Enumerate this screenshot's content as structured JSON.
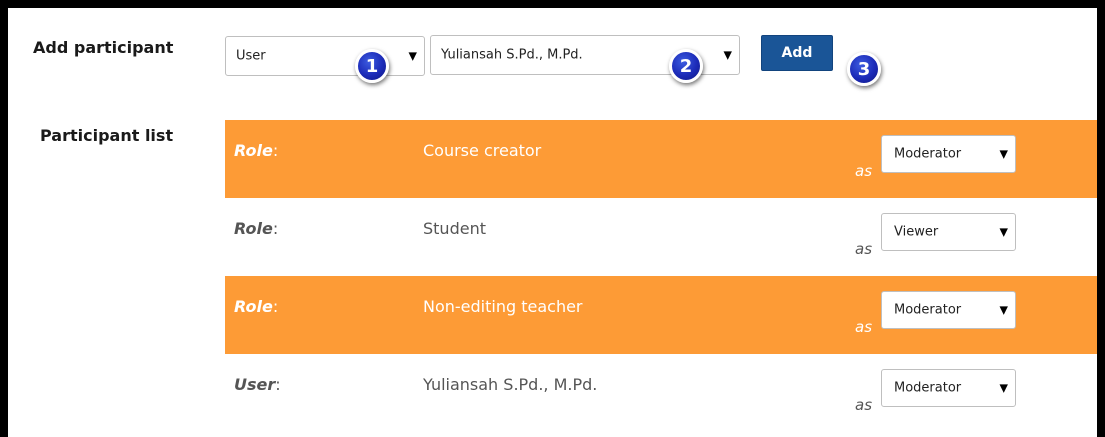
{
  "add_participant": {
    "label": "Add participant",
    "type_select_value": "User",
    "person_select_value": "Yuliansah S.Pd., M.Pd.",
    "add_button_label": "Add",
    "badges": [
      "1",
      "2",
      "3"
    ]
  },
  "participant_list": {
    "label": "Participant list",
    "as_text": "as",
    "rows": [
      {
        "keyword": "Role",
        "colon": ":",
        "value": "Course creator",
        "permission": "Moderator"
      },
      {
        "keyword": "Role",
        "colon": ":",
        "value": "Student",
        "permission": "Viewer"
      },
      {
        "keyword": "Role",
        "colon": ":",
        "value": "Non-editing teacher",
        "permission": "Moderator"
      },
      {
        "keyword": "User",
        "colon": ":",
        "value": "Yuliansah S.Pd., M.Pd.",
        "permission": "Moderator"
      }
    ]
  },
  "colors": {
    "accent_orange": "#fd9b36",
    "button_blue": "#1a5597",
    "badge_blue": "#1c2bb8"
  },
  "icons": {
    "dropdown": "caret-down-icon",
    "badge": "numbered-circle-icon"
  }
}
